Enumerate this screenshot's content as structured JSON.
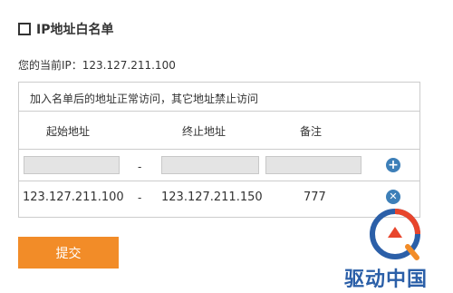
{
  "section": {
    "title": "IP地址白名单"
  },
  "current_ip": {
    "text": "您的当前IP：123.127.211.100"
  },
  "whitelist": {
    "note": "加入名单后的地址正常访问，其它地址禁止访问",
    "headers": {
      "start": "起始地址",
      "end": "终止地址",
      "remark": "备注"
    },
    "separator": "-",
    "input_row": {
      "start": "",
      "end": "",
      "remark": ""
    },
    "entries": [
      {
        "start": "123.127.211.100",
        "end": "123.127.211.150",
        "remark": "777"
      }
    ]
  },
  "actions": {
    "submit_label": "提交"
  },
  "icons": {
    "add": "plus-circle-icon",
    "delete": "x-circle-icon"
  },
  "watermark": {
    "text": "驱动中国"
  },
  "colors": {
    "accent": "#f28c28",
    "icon_blue": "#3d7fb8",
    "border": "#cccccc",
    "input_bg": "#e4e4e4"
  }
}
